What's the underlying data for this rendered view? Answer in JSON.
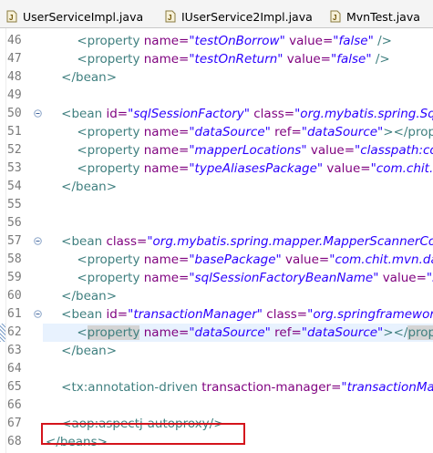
{
  "tabs": [
    {
      "label": "UserServiceImpl.java",
      "icon": "java-file-icon"
    },
    {
      "label": "IUserService2Impl.java",
      "icon": "java-interface-file-icon"
    },
    {
      "label": "MvnTest.java",
      "icon": "java-file-icon"
    }
  ],
  "lines": [
    {
      "num": "46",
      "segs": [
        [
          "t",
          "        <property "
        ],
        [
          "a",
          "name="
        ],
        [
          "v",
          "\"testOnBorrow\""
        ],
        [
          "a",
          " value="
        ],
        [
          "v",
          "\"false\""
        ],
        [
          "t",
          " />"
        ]
      ]
    },
    {
      "num": "47",
      "segs": [
        [
          "t",
          "        <property "
        ],
        [
          "a",
          "name="
        ],
        [
          "v",
          "\"testOnReturn\""
        ],
        [
          "a",
          " value="
        ],
        [
          "v",
          "\"false\""
        ],
        [
          "t",
          " />"
        ]
      ]
    },
    {
      "num": "48",
      "segs": [
        [
          "t",
          "    </bean>"
        ]
      ]
    },
    {
      "num": "49",
      "segs": []
    },
    {
      "num": "50",
      "fold": true,
      "segs": [
        [
          "t",
          "    <bean "
        ],
        [
          "a",
          "id="
        ],
        [
          "v",
          "\"sqlSessionFactory\""
        ],
        [
          "a",
          " class="
        ],
        [
          "v",
          "\"org.mybatis.spring.SqlS"
        ]
      ]
    },
    {
      "num": "51",
      "segs": [
        [
          "t",
          "        <property "
        ],
        [
          "a",
          "name="
        ],
        [
          "v",
          "\"dataSource\""
        ],
        [
          "a",
          " ref="
        ],
        [
          "v",
          "\"dataSource\""
        ],
        [
          "t",
          "></prope"
        ]
      ]
    },
    {
      "num": "52",
      "segs": [
        [
          "t",
          "        <property "
        ],
        [
          "a",
          "name="
        ],
        [
          "v",
          "\"mapperLocations\""
        ],
        [
          "a",
          " value="
        ],
        [
          "v",
          "\"classpath:con"
        ]
      ]
    },
    {
      "num": "53",
      "segs": [
        [
          "t",
          "        <property "
        ],
        [
          "a",
          "name="
        ],
        [
          "v",
          "\"typeAliasesPackage\""
        ],
        [
          "a",
          " value="
        ],
        [
          "v",
          "\"com.chit.m"
        ]
      ]
    },
    {
      "num": "54",
      "segs": [
        [
          "t",
          "    </bean>"
        ]
      ]
    },
    {
      "num": "55",
      "segs": []
    },
    {
      "num": "56",
      "segs": []
    },
    {
      "num": "57",
      "fold": true,
      "segs": [
        [
          "t",
          "    <bean "
        ],
        [
          "a",
          "class="
        ],
        [
          "v",
          "\"org.mybatis.spring.mapper.MapperScannerCor"
        ]
      ]
    },
    {
      "num": "58",
      "segs": [
        [
          "t",
          "        <property "
        ],
        [
          "a",
          "name="
        ],
        [
          "v",
          "\"basePackage\""
        ],
        [
          "a",
          " value="
        ],
        [
          "v",
          "\"com.chit.mvn.dao"
        ]
      ]
    },
    {
      "num": "59",
      "segs": [
        [
          "t",
          "        <property "
        ],
        [
          "a",
          "name="
        ],
        [
          "v",
          "\"sqlSessionFactoryBeanName\""
        ],
        [
          "a",
          " value="
        ],
        [
          "v",
          "\"sq"
        ]
      ]
    },
    {
      "num": "60",
      "segs": [
        [
          "t",
          "    </bean>"
        ]
      ]
    },
    {
      "num": "61",
      "fold": true,
      "segs": [
        [
          "t",
          "    <bean "
        ],
        [
          "a",
          "id="
        ],
        [
          "v",
          "\"transactionManager\""
        ],
        [
          "a",
          " class="
        ],
        [
          "v",
          "\"org.springframework"
        ]
      ]
    },
    {
      "num": "62",
      "current": true,
      "segs": [
        [
          "t",
          "        <"
        ],
        [
          "to",
          "property"
        ],
        [
          "a",
          " name="
        ],
        [
          "v",
          "\"dataSource\""
        ],
        [
          "a",
          " ref="
        ],
        [
          "v",
          "\"dataSource\""
        ],
        [
          "t",
          "></"
        ],
        [
          "to",
          "prope"
        ]
      ]
    },
    {
      "num": "63",
      "segs": [
        [
          "t",
          "    </bean>"
        ]
      ]
    },
    {
      "num": "64",
      "segs": []
    },
    {
      "num": "65",
      "segs": [
        [
          "t",
          "    <tx:annotation-driven "
        ],
        [
          "a",
          "transaction-manager="
        ],
        [
          "v",
          "\"transactionMa"
        ]
      ]
    },
    {
      "num": "66",
      "segs": []
    },
    {
      "num": "67",
      "segs": [
        [
          "t",
          "    <aop:aspectj-autoproxy/>"
        ]
      ]
    },
    {
      "num": "68",
      "segs": [
        [
          "t",
          "</beans>"
        ]
      ]
    }
  ],
  "colors": {
    "tag": "#3f7f7f",
    "attribute": "#7f007f",
    "value": "#2a00ff",
    "current_line": "#e8f2fe",
    "highlight_box": "#d4141c"
  }
}
